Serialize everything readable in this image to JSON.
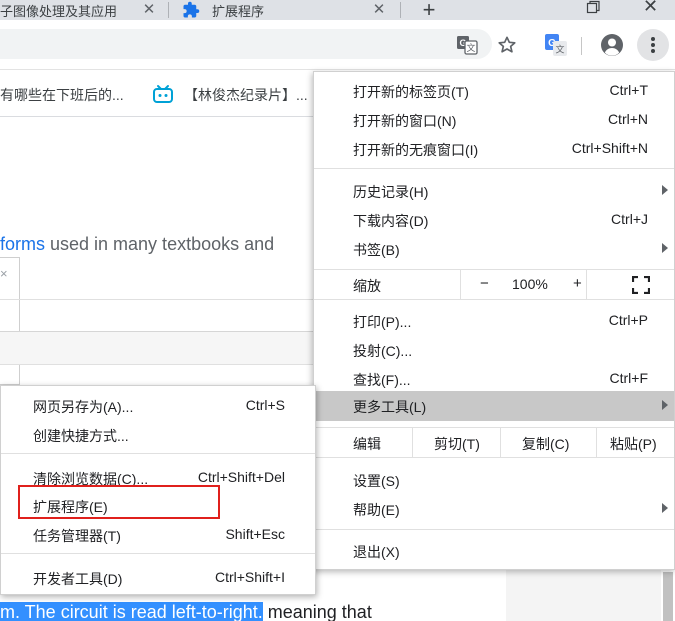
{
  "tabs": [
    {
      "title": "子图像处理及其应用",
      "close": "✕"
    },
    {
      "title": "扩展程序",
      "close": "✕"
    }
  ],
  "window": {
    "new_tab": "+",
    "close": "✕"
  },
  "bookmarks": [
    {
      "label": "有哪些在下班后的..."
    },
    {
      "label": "【林俊杰纪录片】..."
    }
  ],
  "page": {
    "line_link": "forms",
    "line_rest": " used in many textbooks and",
    "side_close": "×",
    "bottom_selected": "m. The circuit is read left-to-right.",
    "bottom_rest": " meaning that"
  },
  "menu": {
    "items_top": [
      {
        "label": "打开新的标签页(T)",
        "shortcut": "Ctrl+T"
      },
      {
        "label": "打开新的窗口(N)",
        "shortcut": "Ctrl+N"
      },
      {
        "label": "打开新的无痕窗口(I)",
        "shortcut": "Ctrl+Shift+N"
      }
    ],
    "items_mid": [
      {
        "label": "历史记录(H)",
        "shortcut": ""
      },
      {
        "label": "下载内容(D)",
        "shortcut": "Ctrl+J"
      },
      {
        "label": "书签(B)",
        "shortcut": ""
      }
    ],
    "zoom": {
      "label": "缩放",
      "minus": "−",
      "value": "100%",
      "plus": "+"
    },
    "items_tools": [
      {
        "label": "打印(P)...",
        "shortcut": "Ctrl+P"
      },
      {
        "label": "投射(C)...",
        "shortcut": ""
      },
      {
        "label": "查找(F)...",
        "shortcut": "Ctrl+F"
      },
      {
        "label": "更多工具(L)",
        "shortcut": ""
      }
    ],
    "edit": {
      "label": "编辑",
      "cut": "剪切(T)",
      "copy": "复制(C)",
      "paste": "粘贴(P)"
    },
    "items_bottom": [
      {
        "label": "设置(S)"
      },
      {
        "label": "帮助(E)"
      }
    ],
    "exit": {
      "label": "退出(X)"
    }
  },
  "submenu": {
    "items": [
      {
        "label": "网页另存为(A)...",
        "shortcut": "Ctrl+S"
      },
      {
        "label": "创建快捷方式...",
        "shortcut": ""
      },
      {
        "label": "清除浏览数据(C)...",
        "shortcut": "Ctrl+Shift+Del"
      },
      {
        "label": "扩展程序(E)",
        "shortcut": ""
      },
      {
        "label": "任务管理器(T)",
        "shortcut": "Shift+Esc"
      },
      {
        "label": "开发者工具(D)",
        "shortcut": "Ctrl+Shift+I"
      }
    ]
  },
  "colors": {
    "highlight": "#c8c8c8",
    "red_outline": "#e0201c",
    "selection": "#3390ff",
    "link": "#1a73e8"
  }
}
